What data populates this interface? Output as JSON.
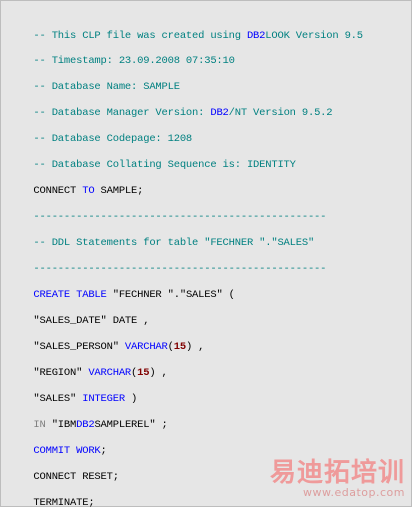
{
  "lines": {
    "l1": {
      "comment": "-- This CLP file was created using ",
      "db2": "DB2",
      "rest": "LOOK Version 9.5"
    },
    "l2": {
      "comment": "-- Timestamp: 23.09.2008 07:35:10"
    },
    "l3": {
      "comment": "-- Database Name: SAMPLE"
    },
    "l4": {
      "comment": "-- Database Manager Version: ",
      "db2": "DB2",
      "rest": "/NT Version 9.5.2"
    },
    "l5": {
      "comment": "-- Database Codepage: 1208"
    },
    "l6": {
      "comment": "-- Database Collating Sequence is: IDENTITY"
    },
    "l7": {
      "a": "CONNECT ",
      "to": "TO",
      "b": " SAMPLE;"
    },
    "sep1": "------------------------------------------------",
    "l8": {
      "comment": "-- DDL Statements for table \"FECHNER \".\"SALES\""
    },
    "sep2": "------------------------------------------------",
    "l9": {
      "kw": "CREATE TABLE",
      "rest": " \"FECHNER \".\"SALES\" ("
    },
    "l10": {
      "text": "\"SALES_DATE\" DATE ,"
    },
    "l11": {
      "a": "\"SALES_PERSON\" ",
      "kw": "VARCHAR",
      "p1": "(",
      "num": "15",
      "p2": ") ,"
    },
    "l12": {
      "a": "\"REGION\" ",
      "kw": "VARCHAR",
      "p1": "(",
      "num": "15",
      "p2": ") ,"
    },
    "l13": {
      "a": "\"SALES\" ",
      "kw": "INTEGER",
      "b": " )"
    },
    "l14": {
      "in": "IN",
      "a": " \"IBM",
      "db2": "DB2",
      "b": "SAMPLEREL\" ;"
    },
    "l15": {
      "kw": "COMMIT WORK",
      "b": ";"
    },
    "l16": {
      "text": "CONNECT RESET;"
    },
    "l17": {
      "text": "TERMINATE;"
    }
  },
  "watermark": {
    "title": "易迪拓培训",
    "url": "www.edatop.com"
  }
}
